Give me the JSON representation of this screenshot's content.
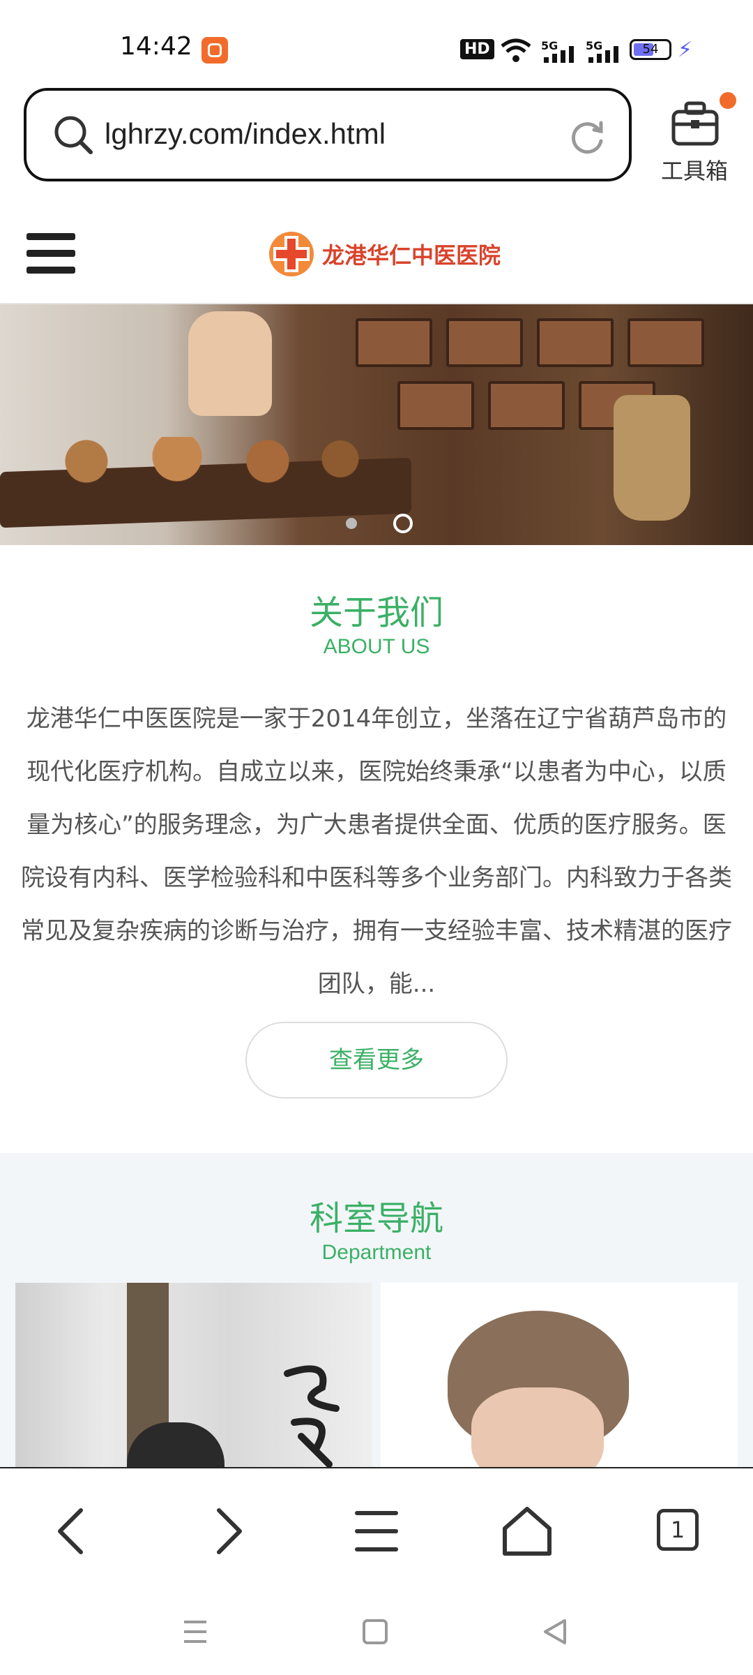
{
  "status_bar": {
    "time": "14:42",
    "network": "HD",
    "signal_1": "5G",
    "signal_2": "5G",
    "battery": "54"
  },
  "address_bar": {
    "url": "lghrzy.com/index.html",
    "toolbox_label": "工具箱"
  },
  "site": {
    "logo_text": "龙港华仁中医医院"
  },
  "about": {
    "title": "关于我们",
    "subtitle": "ABOUT US",
    "body": "龙港华仁中医医院是一家于2014年创立，坐落在辽宁省葫芦岛市的现代化医疗机构。自成立以来，医院始终秉承“以患者为中心，以质量为核心”的服务理念，为广大患者提供全面、优质的医疗服务。医院设有内科、医学检验科和中医科等多个业务部门。内科致力于各类常见及复杂疾病的诊断与治疗，拥有一支经验丰富、技术精湛的医疗团队，能...",
    "more_button": "查看更多"
  },
  "department": {
    "title": "科室导航",
    "subtitle": "Department"
  },
  "colors": {
    "accent_green": "#3bb066",
    "logo_red": "#d9432b",
    "notification_orange": "#f26b2a"
  },
  "icons": {
    "status": [
      "app-notification-icon",
      "hd-icon",
      "wifi-icon",
      "signal-icon",
      "battery-icon",
      "charging-icon"
    ],
    "browser_nav": [
      "back-icon",
      "forward-icon",
      "menu-icon",
      "home-icon",
      "tabs-icon"
    ],
    "system_nav": [
      "recent-apps-icon",
      "home-square-icon",
      "back-triangle-icon"
    ]
  },
  "tabs_count": "1"
}
